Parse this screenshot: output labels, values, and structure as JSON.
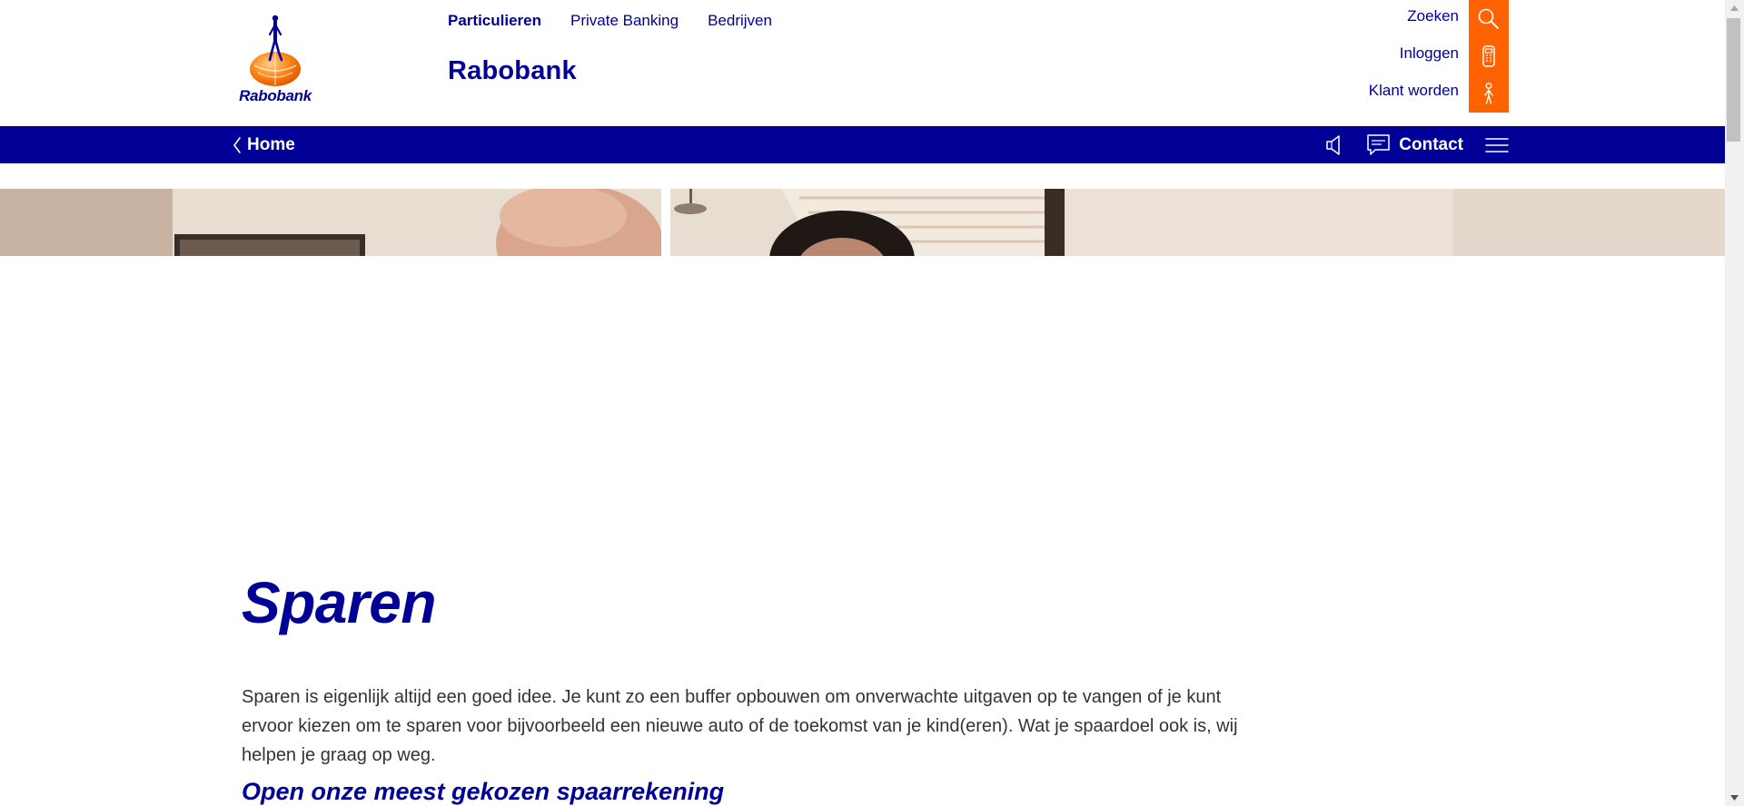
{
  "header": {
    "logo_text": "Rabobank",
    "segments": [
      {
        "label": "Particulieren",
        "active": true
      },
      {
        "label": "Private Banking",
        "active": false
      },
      {
        "label": "Bedrijven",
        "active": false
      }
    ],
    "brand_title": "Rabobank",
    "utility": [
      {
        "label": "Zoeken",
        "icon": "search-icon"
      },
      {
        "label": "Inloggen",
        "icon": "card-reader-icon"
      },
      {
        "label": "Klant worden",
        "icon": "person-icon"
      }
    ]
  },
  "bluebar": {
    "back_label": "Home",
    "contact_label": "Contact",
    "icons": [
      "chevron-left-icon",
      "speaker-icon",
      "chat-icon",
      "hamburger-menu-icon"
    ]
  },
  "main": {
    "title": "Sparen",
    "intro": "Sparen is eigenlijk altijd een goed idee. Je kunt zo een buffer opbouwen om onverwachte uitgaven op te vangen of je kunt ervoor kiezen om te sparen voor bijvoorbeeld een nieuwe auto of de toekomst van je kind(eren). Wat je spaardoel ook is, wij helpen je graag op weg.",
    "subtitle": "Open onze meest gekozen spaarrekening"
  },
  "colors": {
    "brand_blue": "#000096",
    "brand_orange": "#ff6200",
    "text_gray": "#333333"
  }
}
